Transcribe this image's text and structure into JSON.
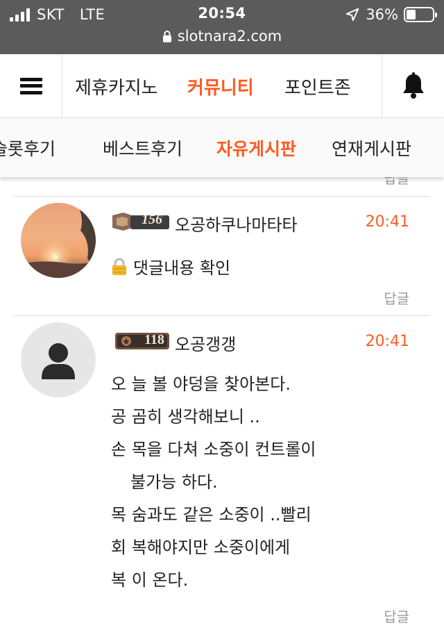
{
  "status_bar": {
    "carrier": "SKT",
    "network": "LTE",
    "time": "20:54",
    "battery_percent": "36%",
    "battery_level": 0.36,
    "url": "slotnara2.com"
  },
  "top_nav": {
    "tabs": [
      {
        "label": "제휴카지노",
        "active": false
      },
      {
        "label": "커뮤니티",
        "active": true
      },
      {
        "label": "포인트존",
        "active": false
      }
    ],
    "icons": [
      "menu-icon",
      "bell-icon"
    ]
  },
  "sub_nav": {
    "tabs": [
      {
        "label": "슬롯후기",
        "active": false
      },
      {
        "label": "베스트후기",
        "active": false
      },
      {
        "label": "자유게시판",
        "active": true
      },
      {
        "label": "연재게시판",
        "active": false
      }
    ]
  },
  "comments": [
    {
      "avatar": "sunset-photo",
      "level": "156",
      "nickname": "오공하쿠나마타타",
      "time": "20:41",
      "locked_text": "댓글내용 확인",
      "reply_label": "답글"
    },
    {
      "avatar": "default-user-icon",
      "level": "118",
      "nickname": "오공갱갱",
      "time": "20:41",
      "lines": [
        "오 늘 볼 야덩을 찾아본다.",
        "공 곰히 생각해보니 ..",
        "손 목을 다쳐 소중이 컨트롤이",
        "불가능 하다.",
        "목 숨과도 같은 소중이 ..빨리",
        "회 복해야지만 소중이에게",
        "복 이 온다."
      ],
      "reply_label": "답글"
    }
  ],
  "partial_reply_label": "답글",
  "colors": {
    "accent": "#ff5a1f",
    "status_bar_bg": "#5b5b5b",
    "muted": "#999999"
  }
}
